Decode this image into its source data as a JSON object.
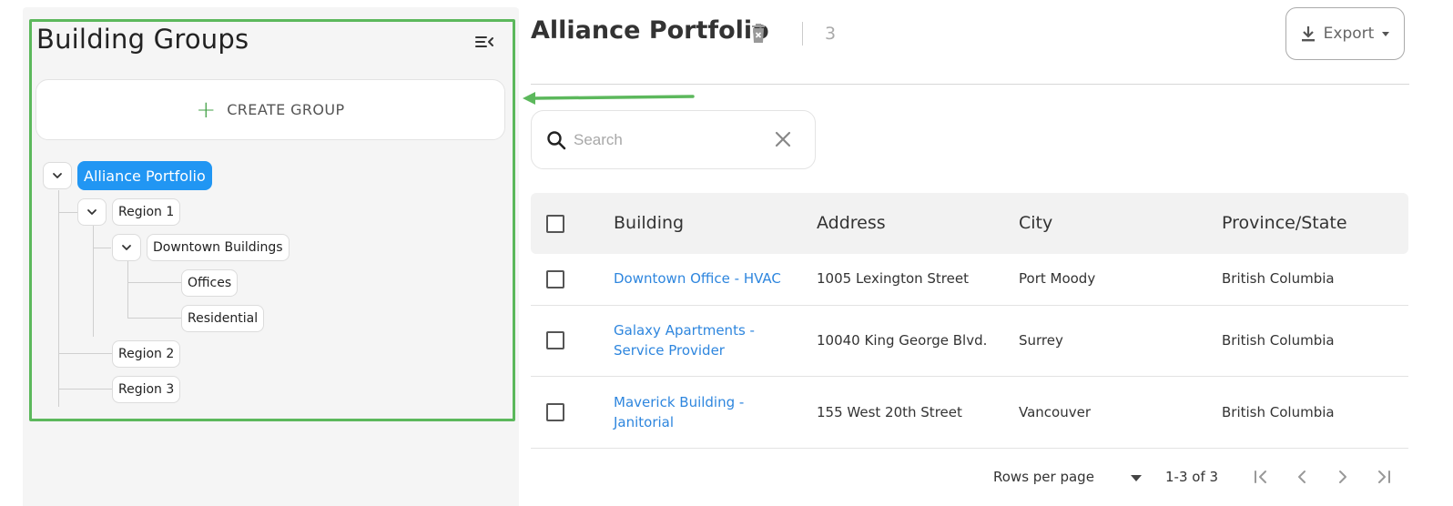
{
  "sidebar": {
    "title": "Building Groups",
    "create_label": "CREATE GROUP",
    "tree": {
      "root": "Alliance Portfolio",
      "region1": "Region 1",
      "downtown": "Downtown Buildings",
      "offices": "Offices",
      "residential": "Residential",
      "region2": "Region 2",
      "region3": "Region 3"
    }
  },
  "header": {
    "title": "Alliance Portfolio",
    "count": "3",
    "export_label": "Export"
  },
  "search": {
    "placeholder": "Search"
  },
  "table": {
    "columns": [
      "Building",
      "Address",
      "City",
      "Province/State"
    ],
    "rows": [
      {
        "building": "Downtown Office - HVAC",
        "address": "1005 Lexington Street",
        "city": "Port Moody",
        "province": "British Columbia"
      },
      {
        "building_line1": "Galaxy Apartments -",
        "building_line2": "Service Provider",
        "address": "10040 King George Blvd.",
        "city": "Surrey",
        "province": "British Columbia"
      },
      {
        "building_line1": "Maverick Building -",
        "building_line2": "Janitorial",
        "address": "155 West 20th Street",
        "city": "Vancouver",
        "province": "British Columbia"
      }
    ]
  },
  "pagination": {
    "rows_per_page_label": "Rows per page",
    "range": "1-3 of 3"
  },
  "colors": {
    "accent": "#2196f3",
    "link": "#2e86de",
    "highlight": "#5cb85c",
    "plus": "#43a047"
  },
  "icons": [
    "collapse-menu-icon",
    "plus-icon",
    "chevron-down-icon",
    "delete-icon",
    "download-icon",
    "caret-down-icon",
    "search-icon",
    "close-icon",
    "first-page-icon",
    "prev-page-icon",
    "next-page-icon",
    "last-page-icon"
  ]
}
